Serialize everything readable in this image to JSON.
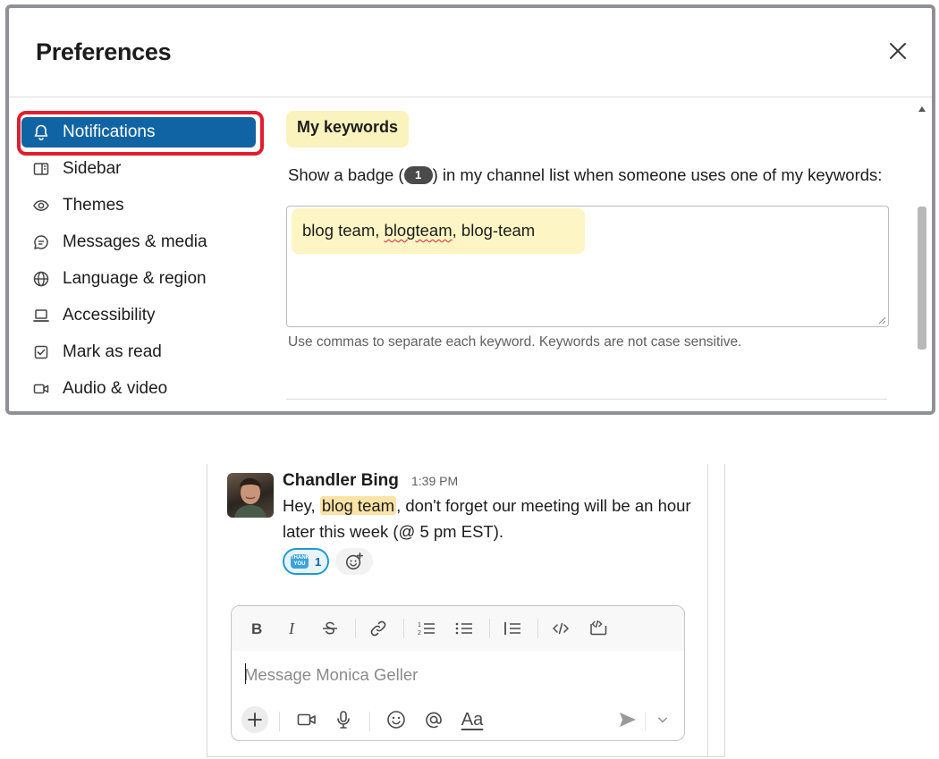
{
  "preferences": {
    "title": "Preferences",
    "nav": [
      {
        "label": "Notifications",
        "icon": "bell-icon",
        "active": true
      },
      {
        "label": "Sidebar",
        "icon": "sidebar-icon"
      },
      {
        "label": "Themes",
        "icon": "eye-icon"
      },
      {
        "label": "Messages & media",
        "icon": "message-icon"
      },
      {
        "label": "Language & region",
        "icon": "globe-icon"
      },
      {
        "label": "Accessibility",
        "icon": "laptop-icon"
      },
      {
        "label": "Mark as read",
        "icon": "checkbox-icon"
      },
      {
        "label": "Audio & video",
        "icon": "video-icon"
      }
    ],
    "keywords": {
      "heading": "My keywords",
      "desc_before": "Show a badge (",
      "badge": "1",
      "desc_after": ") in my channel list when someone uses one of my keywords:",
      "value_part1": "blog team, ",
      "value_misspelled": "blogteam",
      "value_part2": ", blog-team",
      "hint": "Use commas to separate each keyword. Keywords are not case sensitive."
    }
  },
  "message": {
    "sender": "Chandler Bing",
    "time": "1:39 PM",
    "text_before": "Hey, ",
    "keyword": "blog team",
    "text_after": ", don't forget our meeting will be an hour later this week (@ 5 pm EST).",
    "reaction": {
      "emoji": "THANK YOU",
      "count": "1"
    }
  },
  "composer": {
    "placeholder": "Message Monica Geller",
    "format_icons": [
      "bold-icon",
      "italic-icon",
      "strikethrough-icon",
      "link-icon",
      "ordered-list-icon",
      "bullet-list-icon",
      "blockquote-icon",
      "code-icon",
      "code-block-icon"
    ],
    "bottom_icons": [
      "plus-icon",
      "video-icon",
      "microphone-icon",
      "emoji-icon",
      "mention-icon",
      "format-toggle-icon",
      "send-icon",
      "chevron-down-icon"
    ],
    "format_label": "Aa"
  },
  "colors": {
    "accent": "#1164a3",
    "highlight_ring": "#e01e2e",
    "keyword_bg": "#fbf3bd"
  }
}
